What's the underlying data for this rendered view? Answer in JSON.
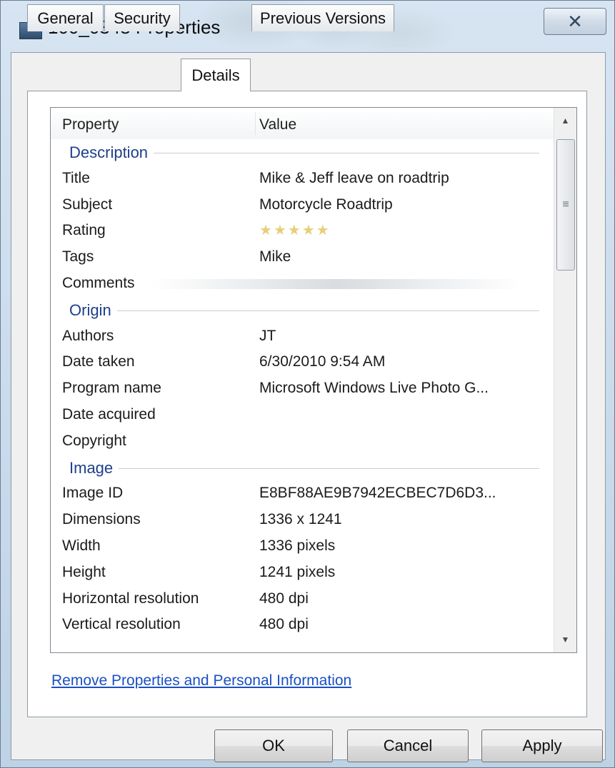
{
  "window": {
    "title": "100_0348 Properties",
    "close_glyph": "✕"
  },
  "tabs": [
    {
      "label": "General",
      "active": false
    },
    {
      "label": "Security",
      "active": false
    },
    {
      "label": "Details",
      "active": true
    },
    {
      "label": "Previous Versions",
      "active": false
    }
  ],
  "list": {
    "header": {
      "property": "Property",
      "value": "Value"
    },
    "sections": [
      {
        "label": "Description",
        "rows": [
          {
            "name": "Title",
            "value": "Mike & Jeff leave on roadtrip"
          },
          {
            "name": "Subject",
            "value": "Motorcycle Roadtrip"
          },
          {
            "name": "Rating",
            "value": "",
            "rating": 0,
            "rating_max": 5
          },
          {
            "name": "Tags",
            "value": "Mike"
          },
          {
            "name": "Comments",
            "value": ""
          }
        ]
      },
      {
        "label": "Origin",
        "rows": [
          {
            "name": "Authors",
            "value": "JT"
          },
          {
            "name": "Date taken",
            "value": "6/30/2010 9:54 AM"
          },
          {
            "name": "Program name",
            "value": "Microsoft Windows Live Photo G..."
          },
          {
            "name": "Date acquired",
            "value": ""
          },
          {
            "name": "Copyright",
            "value": ""
          }
        ]
      },
      {
        "label": "Image",
        "rows": [
          {
            "name": "Image ID",
            "value": "E8BF88AE9B7942ECBEC7D6D3..."
          },
          {
            "name": "Dimensions",
            "value": "1336 x 1241"
          },
          {
            "name": "Width",
            "value": "1336 pixels"
          },
          {
            "name": "Height",
            "value": "1241 pixels"
          },
          {
            "name": "Horizontal resolution",
            "value": "480 dpi"
          },
          {
            "name": "Vertical resolution",
            "value": "480 dpi"
          }
        ]
      }
    ]
  },
  "links": {
    "remove_properties": "Remove Properties and Personal Information"
  },
  "buttons": {
    "ok": "OK",
    "cancel": "Cancel",
    "apply": "Apply"
  },
  "colors": {
    "section_header": "#1e3f8a",
    "link": "#1a4fc4",
    "star_empty": "#e6cf7a"
  }
}
